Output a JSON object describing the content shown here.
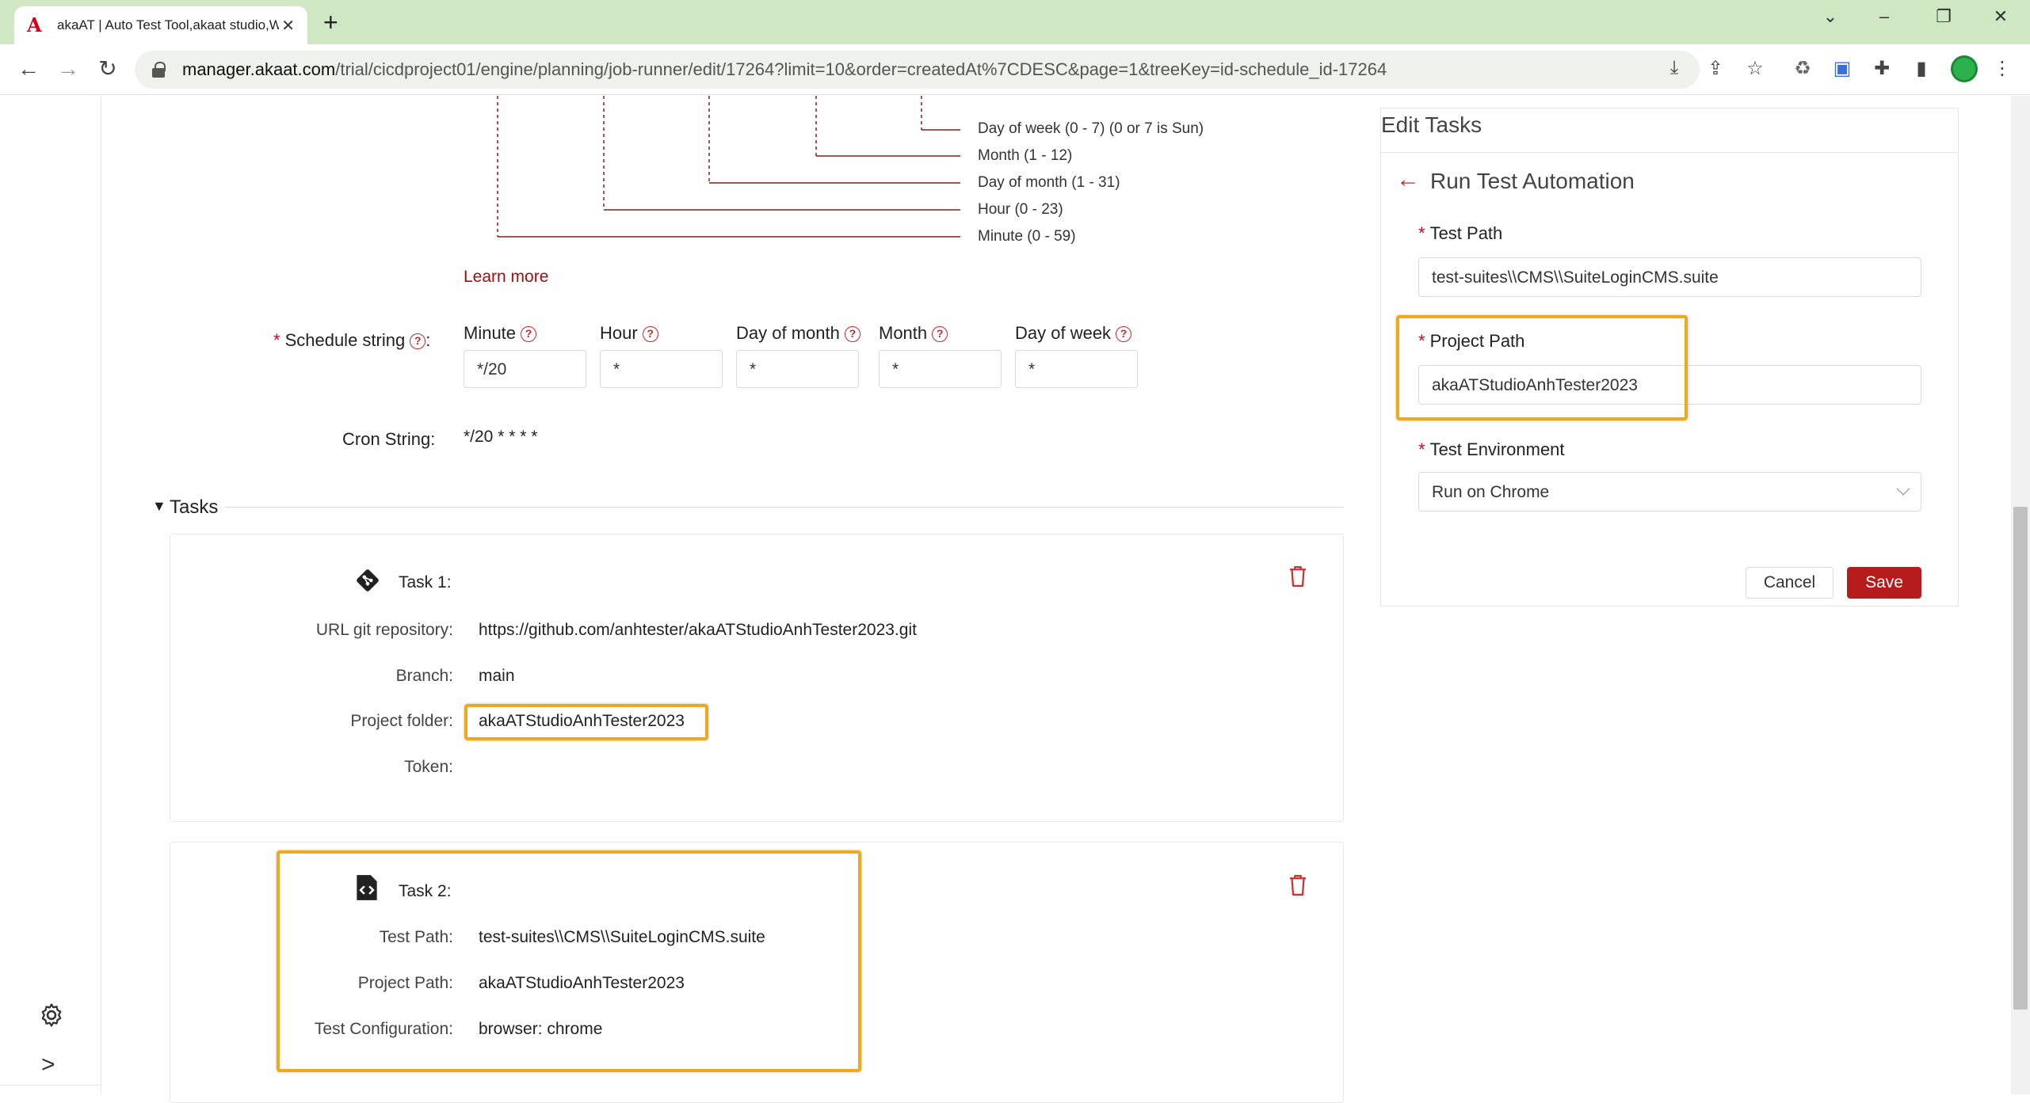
{
  "browser": {
    "tab_title": "akaAT | Auto Test Tool,akaat studio,Web",
    "url_host": "manager.akaat.com",
    "url_path": "/trial/cicdproject01/engine/planning/job-runner/edit/17264?limit=10&order=createdAt%7CDESC&page=1&treeKey=id-schedule_id-17264",
    "tab_logo": "A",
    "close_glyph": "✕",
    "new_tab_glyph": "+"
  },
  "cron_diagram": {
    "day_of_week": "Day of week (0 - 7) (0 or 7 is Sun)",
    "month": "Month (1 - 12)",
    "day_of_month": "Day of month (1 - 31)",
    "hour": "Hour (0 - 23)",
    "minute": "Minute (0 - 59)"
  },
  "learn_more": "Learn more",
  "schedule": {
    "label": "Schedule string",
    "required_mark": "*",
    "help_glyph": "?",
    "colon": ":",
    "fields": [
      {
        "label": "Minute",
        "value": "*/20"
      },
      {
        "label": "Hour",
        "value": "*"
      },
      {
        "label": "Day of month",
        "value": "*"
      },
      {
        "label": "Month",
        "value": "*"
      },
      {
        "label": "Day of week",
        "value": "*"
      }
    ]
  },
  "cron_string": {
    "label": "Cron String",
    "value": "*/20 * * * *"
  },
  "tasks_section": {
    "title": "Tasks",
    "toggle_glyph": "▼"
  },
  "task1": {
    "title": "Task 1",
    "rows": [
      {
        "label": "URL git repository",
        "value": "https://github.com/anhtester/akaATStudioAnhTester2023.git"
      },
      {
        "label": "Branch",
        "value": "main"
      },
      {
        "label": "Project folder",
        "value": "akaATStudioAnhTester2023"
      },
      {
        "label": "Token",
        "value": ""
      }
    ]
  },
  "task2": {
    "title": "Task 2",
    "rows": [
      {
        "label": "Test Path",
        "value": "test-suites\\\\CMS\\\\SuiteLoginCMS.suite"
      },
      {
        "label": "Project Path",
        "value": "akaATStudioAnhTester2023"
      },
      {
        "label": "Test Configuration",
        "value": "browser: chrome"
      }
    ]
  },
  "edit_panel": {
    "title": "Edit Tasks",
    "back_glyph": "←",
    "subtitle": "Run Test Automation",
    "test_path_label": "Test Path",
    "test_path_value": "test-suites\\\\CMS\\\\SuiteLoginCMS.suite",
    "project_path_label": "Project Path",
    "project_path_value": "akaATStudioAnhTester2023",
    "test_env_label": "Test Environment",
    "test_env_value": "Run on Chrome",
    "cancel_label": "Cancel",
    "save_label": "Save"
  },
  "sidebar": {
    "expand_glyph": ">"
  },
  "colors": {
    "brand_red": "#b71c1c",
    "highlight": "#f0a91d",
    "tabbar_green": "#cfe8c3"
  }
}
